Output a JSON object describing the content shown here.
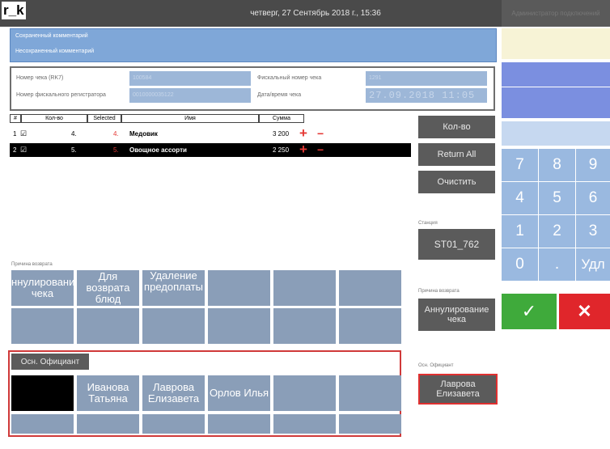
{
  "app": {
    "name": "r_k",
    "datetime": "четверг, 27 Сентябрь 2018 г., 15:36",
    "top_right": "Администратор подключений"
  },
  "comments": {
    "saved": "Сохраненный комментарий",
    "unsaved": "Несохраненный комментарий"
  },
  "info": {
    "check_number_label": "Номер чека (RK7)",
    "check_number_value": "100584",
    "fiscal_check_label": "Фискальный номер чека",
    "fiscal_check_value": "1291",
    "fiscal_reg_label": "Номер фискального регистратора",
    "fiscal_reg_value": "0010000035122",
    "datetime_label": "Дата/время чека",
    "datetime_value": "27.09.2018 11:05"
  },
  "table": {
    "headers": [
      "#",
      "Кол-во",
      "Selected",
      "Имя",
      "Сумма"
    ],
    "rows": [
      {
        "num": "1",
        "qty": "4.",
        "selected": "4.",
        "name": "Медовик",
        "sum": "3 200"
      },
      {
        "num": "2",
        "qty": "5.",
        "selected": "5.",
        "name": "Овощное ассорти",
        "sum": "2 250"
      }
    ]
  },
  "buttons": {
    "qty": "Кол-во",
    "return_all": "Return All",
    "clear": "Очистить"
  },
  "station": {
    "label": "Станция",
    "value": "ST01_762"
  },
  "reason": {
    "label": "Причина возврата",
    "options": [
      "Аннулирование чека",
      "Для возврата блюд",
      "Удаление предоплаты"
    ],
    "selected_label": "Причина возврата",
    "selected_value": "Аннулирование чека"
  },
  "waiter": {
    "tab": "Осн. Официант",
    "options": [
      "Иванова Татьяна",
      "Лаврова Елизавета",
      "Орлов Илья"
    ],
    "selected_label": "Осн. Официант",
    "selected_value": "Лаврова Елизавета"
  },
  "keypad": {
    "keys": [
      "7",
      "8",
      "9",
      "4",
      "5",
      "6",
      "1",
      "2",
      "3",
      "0",
      ".",
      "Удл"
    ]
  },
  "colors": {
    "accent_blue": "#9ab9e0",
    "confirm_green": "#3faa3b",
    "cancel_red": "#e0262b",
    "selected_row": "#000000"
  }
}
